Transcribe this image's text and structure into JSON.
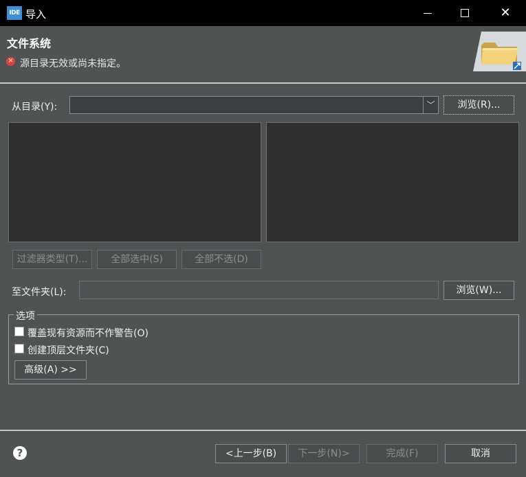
{
  "window": {
    "app_logo_text": "IDE",
    "title": "导入",
    "controls": {
      "minimize": "minimize-icon",
      "maximize": "maximize-icon",
      "close": "close-icon"
    }
  },
  "header": {
    "title": "文件系统",
    "error_message": "源目录无效或尚未指定。",
    "banner_icon": "folder-icon"
  },
  "source": {
    "label": "从目录(Y):",
    "value": "",
    "browse_label": "浏览(R)..."
  },
  "filters": {
    "filter_types_label": "过滤器类型(T)...",
    "select_all_label": "全部选中(S)",
    "deselect_all_label": "全部不选(D)"
  },
  "target": {
    "label": "至文件夹(L):",
    "value": "",
    "browse_label": "浏览(W)..."
  },
  "options": {
    "legend": "选项",
    "overwrite_label": "覆盖现有资源而不作警告(O)",
    "overwrite_checked": false,
    "create_top_label": "创建顶层文件夹(C)",
    "create_top_checked": false,
    "advanced_label": "高级(A) >>"
  },
  "footer": {
    "help_icon": "help-icon",
    "back_label": "<上一步(B)",
    "next_label": "下一步(N)>",
    "finish_label": "完成(F)",
    "cancel_label": "取消"
  },
  "colors": {
    "titlebar_bg": "#000000",
    "dialog_bg": "#505354",
    "pane_bg": "#2f2f2f",
    "error_red": "#d9443c",
    "logo_blue": "#3e8fd6"
  }
}
